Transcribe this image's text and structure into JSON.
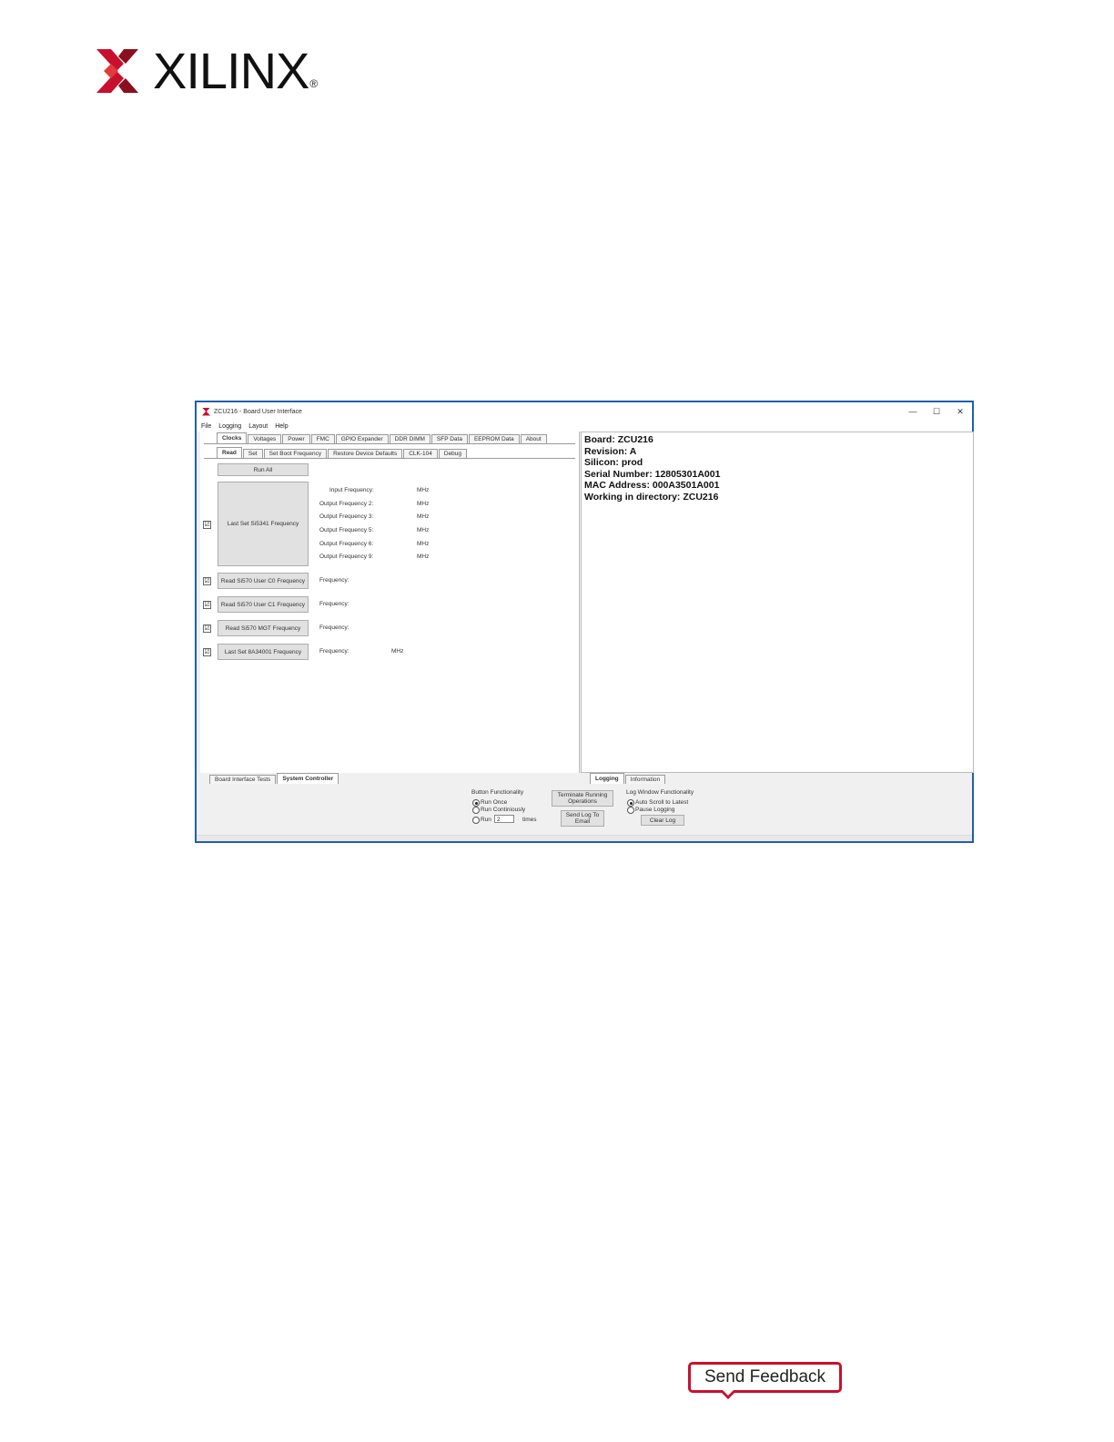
{
  "logo": {
    "brand": "XILINX",
    "reg": "®",
    "icon": "xilinx-x-icon",
    "color": "#c8102e"
  },
  "window": {
    "title": "ZCU216 - Board User Interface",
    "controls": {
      "minimize": "—",
      "maximize": "☐",
      "close": "✕"
    },
    "menu": [
      "File",
      "Logging",
      "Layout",
      "Help"
    ],
    "main_tabs": [
      "Clocks",
      "Voltages",
      "Power",
      "FMC",
      "GPIO Expander",
      "DDR DIMM",
      "SFP Data",
      "EEPROM Data",
      "About"
    ],
    "sub_tabs": [
      "Read",
      "Set",
      "Set Boot Frequency",
      "Restore Device Defaults",
      "CLK-104",
      "Debug"
    ],
    "run_all": "Run All",
    "si5341": {
      "button": "Last Set Si5341 Frequency",
      "rows": [
        {
          "label": "Input Frequency:",
          "unit": "MHz"
        },
        {
          "label": "Output Frequency 2:",
          "unit": "MHz"
        },
        {
          "label": "Output Frequency 3:",
          "unit": "MHz"
        },
        {
          "label": "Output Frequency 5:",
          "unit": "MHz"
        },
        {
          "label": "Output Frequency 6:",
          "unit": "MHz"
        },
        {
          "label": "Output Frequency 9:",
          "unit": "MHz"
        }
      ]
    },
    "reads": [
      {
        "button": "Read Si570 User C0 Frequency",
        "label": "Frequency:",
        "unit": ""
      },
      {
        "button": "Read Si570 User C1 Frequency",
        "label": "Frequency:",
        "unit": ""
      },
      {
        "button": "Read Si570 MGT Frequency",
        "label": "Frequency:",
        "unit": ""
      },
      {
        "button": "Last Set 8A34001 Frequency",
        "label": "Frequency:",
        "unit": "MHz"
      }
    ],
    "check_mark": "☑",
    "info": {
      "board": "Board: ZCU216",
      "revision": "Revision: A",
      "silicon": "Silicon: prod",
      "serial": "Serial Number: 12805301A001",
      "mac": "MAC Address: 000A3501A001",
      "dir": "Working in directory: ZCU216"
    },
    "bottom_tabs_left": [
      "Board Interface Tests",
      "System Controller"
    ],
    "bottom_tabs_right": [
      "Logging",
      "Information"
    ],
    "button_func": {
      "title": "Button Functionality",
      "run_once": "Run Once",
      "run_cont": "Run Continiously",
      "run": "Run",
      "times_value": "2",
      "times": "times"
    },
    "terminate": "Terminate Running Operations",
    "send_log": "Send Log To Email",
    "log_func": {
      "title": "Log Window Functionality",
      "auto_scroll": "Auto Scroll to Latest",
      "pause": "Pause Logging",
      "clear": "Clear Log"
    }
  },
  "feedback": "Send Feedback"
}
